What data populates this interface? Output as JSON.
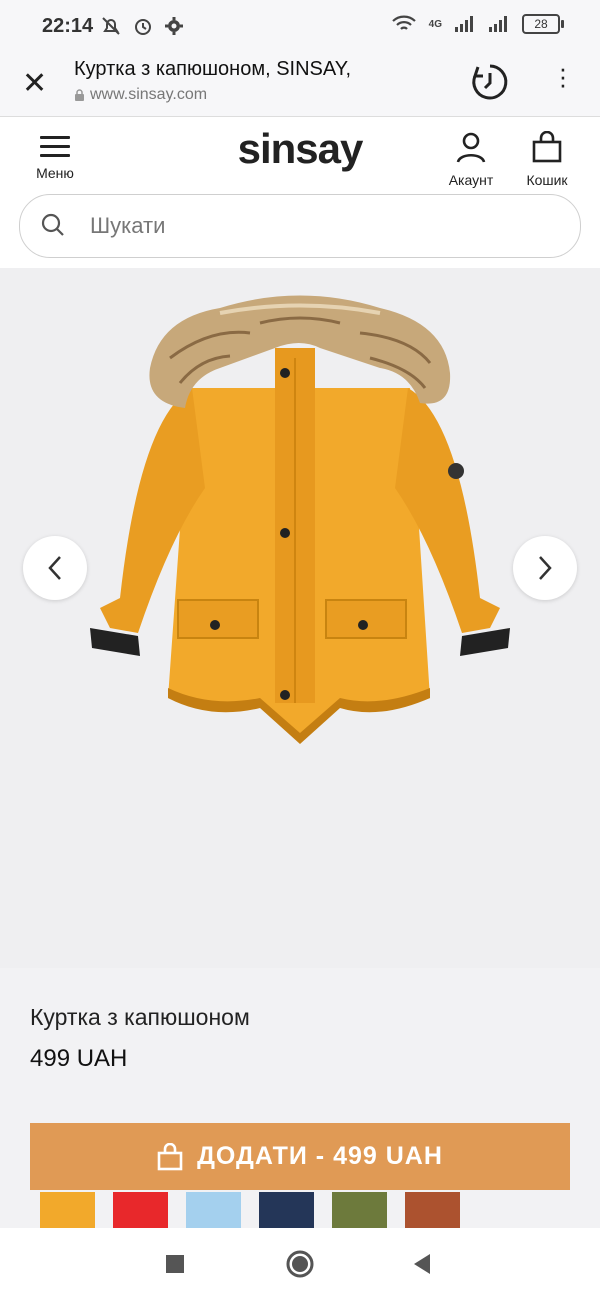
{
  "status": {
    "time": "22:14",
    "network": "4G",
    "battery": "28"
  },
  "browser": {
    "title": "Куртка з капюшоном, SINSAY,",
    "url": "www.sinsay.com"
  },
  "header": {
    "menu_label": "Меню",
    "logo": "sinsay",
    "account_label": "Акаунт",
    "cart_label": "Кошик"
  },
  "search": {
    "placeholder": "Шукати"
  },
  "product": {
    "name": "Куртка з капюшоном",
    "price": "499 UAH",
    "add_button": "ДОДАТИ - 499 UAH"
  },
  "colors": {
    "accent": "#e09a55",
    "jacket": "#f2a92b"
  },
  "swatches": [
    "#f2a92b",
    "#e8282b",
    "#a4d0ee",
    "#243658",
    "#6d7a3c",
    "#ac522f"
  ]
}
